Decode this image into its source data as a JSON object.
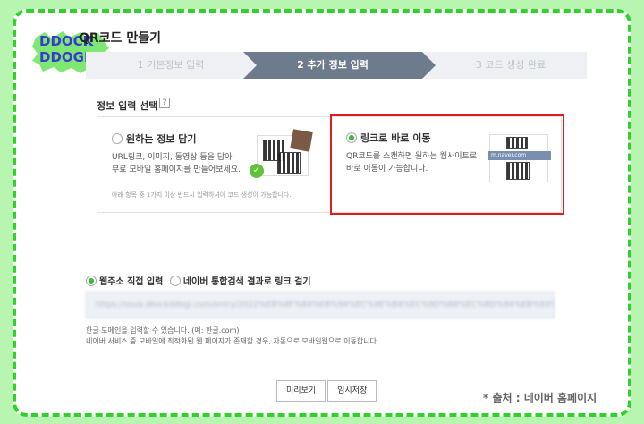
{
  "brand": {
    "line1": "DDOCK",
    "line2": "DDOGI"
  },
  "page_title": "QR코드 만들기",
  "steps": [
    {
      "label": "1 기본정보 입력"
    },
    {
      "label": "2 추가 정보 입력"
    },
    {
      "label": "3 코드 생성 완료"
    }
  ],
  "section": {
    "label": "정보 입력 선택",
    "help": "?"
  },
  "options": [
    {
      "title": "원하는 정보 담기",
      "desc_line1": "URL링크, 이미지, 동영상 등을 담아",
      "desc_line2": "무료 모바일 홈페이지를 만들어보세요.",
      "note": "아래 항목 중 1가지 이상 반드시 입력하셔야 코드 생성이 가능합니다.",
      "selected": false
    },
    {
      "title": "링크로 바로 이동",
      "desc_line1": "QR코드를 스캔하면 원하는 웹사이트로",
      "desc_line2": "바로 이동이 가능합니다.",
      "address_sample": "m.naver.com",
      "selected": true
    }
  ],
  "link_mode": [
    {
      "label": "웹주소 직접 입력",
      "selected": true
    },
    {
      "label": "네이버 통합검색 결과로 링크 걸기",
      "selected": false
    }
  ],
  "url_value": "https://ssua.dkockddogi.com/entry/2022%EB%8F%84%EB%94%EC%9E%B4%EC%9D%B8%EC%BD%94%EB%93%9C",
  "help_line1": "한글 도메인을 입력할 수 있습니다. (예: 한글.com)",
  "help_line2": "네이버 서비스 중 모바일에 최적화된 웹 페이지가 존재할 경우, 자동으로 모바일웹으로 이동합니다.",
  "buttons": {
    "preview": "미리보기",
    "save_temp": "임시저장"
  },
  "source": "* 출처 : 네이버 홈페이지",
  "colors": {
    "accent_green": "#2fd12a",
    "selected_border": "#d9201f",
    "active_step": "#6e7b8c"
  }
}
